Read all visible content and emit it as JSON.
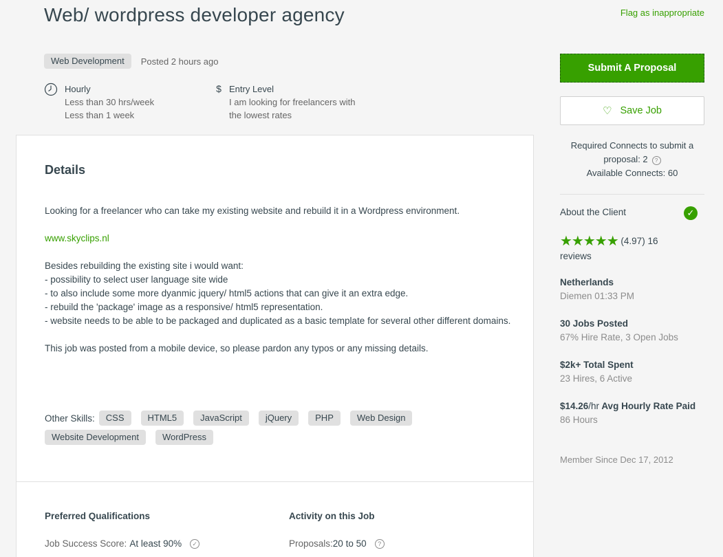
{
  "job": {
    "title": "Web/ wordpress developer agency",
    "flag_label": "Flag as inappropriate",
    "category": "Web Development",
    "posted": "Posted 2 hours ago",
    "type_label": "Hourly",
    "type_sub1": "Less than 30 hrs/week",
    "type_sub2": "Less than 1 week",
    "level_icon": "$",
    "level_label": "Entry Level",
    "level_sub1": "I am looking for freelancers with",
    "level_sub2": "the lowest rates"
  },
  "details": {
    "heading": "Details",
    "para1": "Looking for a freelancer who can take my existing website and rebuild it in a Wordpress environment.",
    "link": "www.skyclips.nl",
    "para2": "Besides rebuilding the existing site i would want:\n- possibility to select user language site wide\n- to also include some more dyanmic jquery/ html5 actions that can give it an extra edge.\n- rebuild the 'package' image as a responsive/ html5 representation.\n- website needs to be able to be packaged and duplicated as a basic template for several other different domains.",
    "para3": "This job was posted from a mobile device, so please pardon any typos or any missing details.",
    "skills_label": "Other Skills:",
    "skills": [
      "CSS",
      "HTML5",
      "JavaScript",
      "jQuery",
      "PHP",
      "Web Design",
      "Website Development",
      "WordPress"
    ]
  },
  "qualifications": {
    "heading": "Preferred Qualifications",
    "jss_label": "Job Success Score:",
    "jss_value": "At least 90%",
    "activity_heading": "Activity on this Job",
    "proposals_label": "Proposals:",
    "proposals_value": "20 to 50"
  },
  "sidebar": {
    "submit_label": "Submit A Proposal",
    "save_label": "Save Job",
    "connects_line1": "Required Connects to submit a",
    "connects_line2": "proposal: 2",
    "connects_line3": "Available Connects: 60",
    "about_client": "About the Client",
    "rating": "(4.97) 16",
    "rating_value": 4.97,
    "reviews_word": "reviews",
    "country": "Netherlands",
    "city_time": "Diemen 01:33 PM",
    "jobs_posted": "30 Jobs Posted",
    "hire_rate": "67% Hire Rate, 3 Open Jobs",
    "total_spent": "$2k+ Total Spent",
    "hires": "23 Hires, 6 Active",
    "rate_value": "$14.26",
    "rate_unit": "/hr",
    "rate_label": "Avg Hourly Rate Paid",
    "hours": "86 Hours",
    "member_since": "Member Since Dec 17, 2012"
  },
  "colors": {
    "accent": "#37a000",
    "text": "#37474f",
    "muted": "#656565",
    "tag_bg": "#e0e0e0"
  }
}
